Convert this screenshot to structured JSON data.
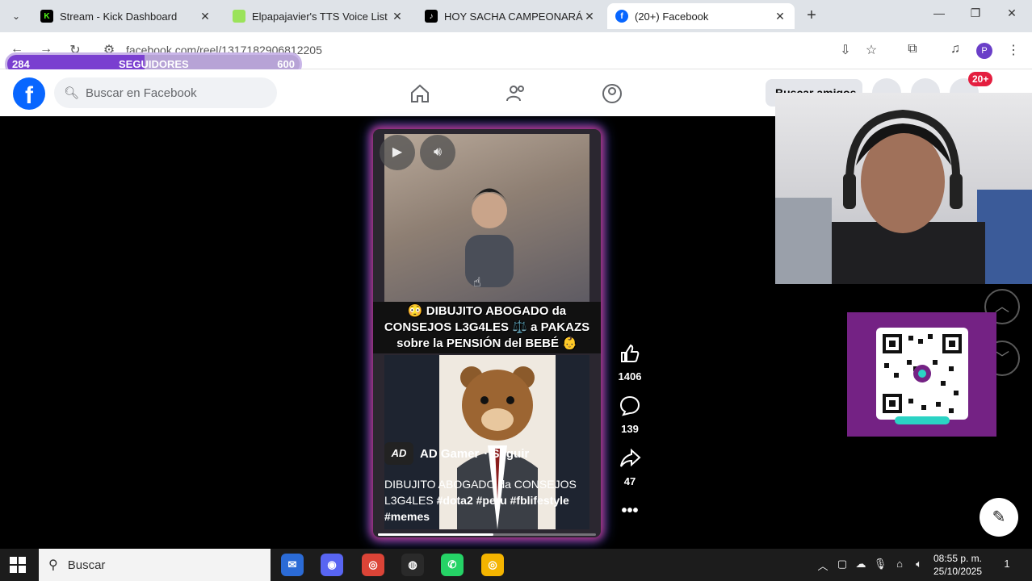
{
  "browser": {
    "tabs": [
      {
        "title": "Stream - Kick Dashboard",
        "favicon": "kick-icon",
        "color": "#53fc18"
      },
      {
        "title": "Elpapajavier's TTS Voice List",
        "favicon": "tts-icon",
        "color": "#9be35a"
      },
      {
        "title": "HOY SACHA CAMPEONARÁ EN",
        "favicon": "tiktok-icon",
        "color": "#000000"
      },
      {
        "title": "(20+) Facebook",
        "favicon": "facebook-icon",
        "color": "#0866ff",
        "active": true
      }
    ],
    "url": "facebook.com/reel/1317182906812205",
    "profile_initial": "P"
  },
  "overlay": {
    "followers_current": "284",
    "followers_label": "SEGUIDORES",
    "followers_goal": "600",
    "followers_progress": 0.47
  },
  "facebook": {
    "search_placeholder": "Buscar en Facebook",
    "find_friends": "Buscar amigos",
    "notifications_badge": "20+"
  },
  "reel": {
    "caption_line1": "😳 DIBUJITO ABOGADO da",
    "caption_line2": "CONSEJOS L3G4LES ⚖️ a PAKAZS",
    "caption_line3": "sobre la PENSIÓN del BEBÉ 👶",
    "author": "AD Gamer",
    "author_avatar": "AD",
    "follow": "· Seguir",
    "desc_text": "DIBUJITO ABOGADO da CONSEJOS L3G4LES",
    "desc_tags": "#dota2 #peru #fblifestyle #memes",
    "likes": "1406",
    "comments": "139",
    "shares": "47",
    "progress": 0.53
  },
  "taskbar": {
    "search": "Buscar",
    "time": "08:55 p. m.",
    "date": "25/10/2025",
    "notification_count": "1"
  },
  "colors": {
    "fb_blue": "#0866ff",
    "qr_panel": "#742284",
    "follower_fill": "#7a3fd0"
  }
}
